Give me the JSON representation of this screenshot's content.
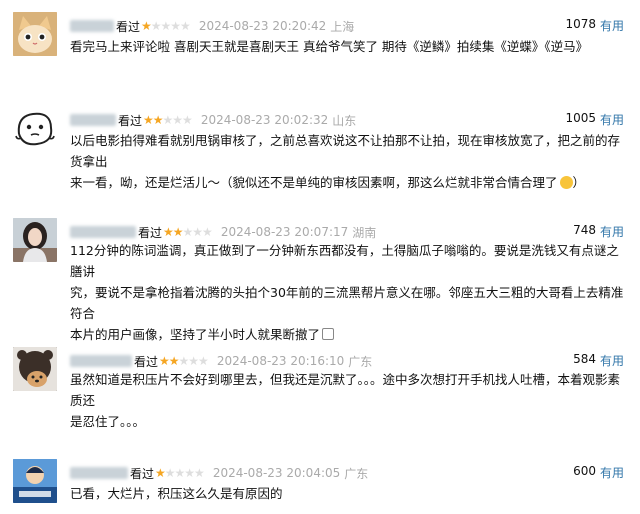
{
  "reviews": [
    {
      "watched": "看过",
      "rating": 1,
      "time": "2024-08-23 20:20:42",
      "location": "上海",
      "votes": "1078",
      "useful_label": "有用",
      "lines": [
        "看完马上来评论啦 喜剧天王就是喜剧天王 真给爷气笑了 期待《逆鳞》拍续集《逆蝶》《逆马》"
      ],
      "avatar_icon": "cat-icon"
    },
    {
      "watched": "看过",
      "rating": 2,
      "time": "2024-08-23 20:02:32",
      "location": "山东",
      "votes": "1005",
      "useful_label": "有用",
      "lines": [
        "以后电影拍得难看就别甩锅审核了，之前总喜欢说这不让拍那不让拍，现在审核放宽了，把之前的存货拿出",
        "来一看，呦，还是烂活儿～（貌似还不是单纯的审核因素啊，那这么烂就非常合情合理了"
      ],
      "avatar_icon": "doodle-face-icon"
    },
    {
      "watched": "看过",
      "rating": 2,
      "time": "2024-08-23 20:07:17",
      "location": "湖南",
      "votes": "748",
      "useful_label": "有用",
      "lines": [
        "112分钟的陈词滥调，真正做到了一分钟新东西都没有，土得脑瓜子嗡嗡的。要说是洗钱又有点谜之膳讲",
        "究，要说不是拿枪指着沈腾的头拍个30年前的三流黑帮片意义在哪。邻座五大三粗的大哥看上去精准符合",
        "本片的用户画像，坚持了半小时人就果断撤了"
      ],
      "avatar_icon": "person-photo-icon"
    },
    {
      "watched": "看过",
      "rating": 2,
      "time": "2024-08-23 20:16:10",
      "location": "广东",
      "votes": "584",
      "useful_label": "有用",
      "lines": [
        "虽然知道是积压片不会好到哪里去，但我还是沉默了。。。途中多次想打开手机找人吐槽，本着观影素质还",
        "是忍住了。。。"
      ],
      "avatar_icon": "bear-dog-icon"
    },
    {
      "watched": "看过",
      "rating": 1,
      "time": "2024-08-23 20:04:05",
      "location": "广东",
      "votes": "600",
      "useful_label": "有用",
      "lines": [
        "已看，大烂片，积压这么久是有原因的"
      ],
      "avatar_icon": "cartoon-avatar-icon"
    }
  ]
}
